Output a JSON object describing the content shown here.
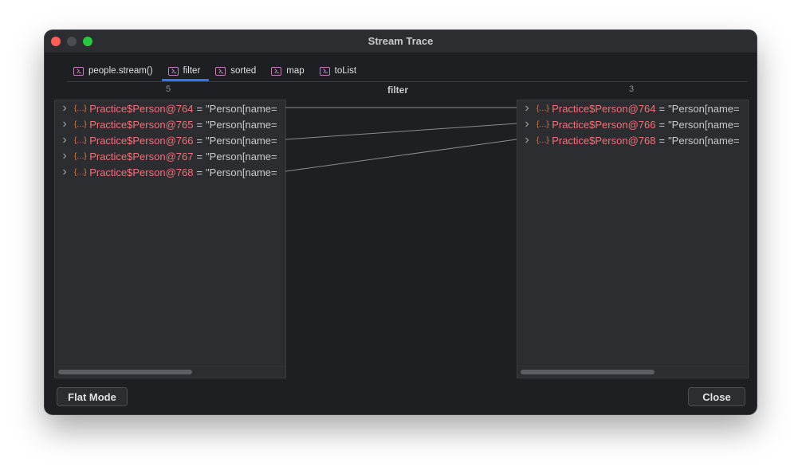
{
  "window": {
    "title": "Stream Trace"
  },
  "tabs": [
    {
      "label": "people.stream()",
      "active": false
    },
    {
      "label": "filter",
      "active": true
    },
    {
      "label": "sorted",
      "active": false
    },
    {
      "label": "map",
      "active": false
    },
    {
      "label": "toList",
      "active": false
    }
  ],
  "section_label": "filter",
  "left_panel": {
    "count": "5",
    "rows": [
      {
        "name": "Practice$Person@764",
        "eq": "=",
        "value": "\"Person[name="
      },
      {
        "name": "Practice$Person@765",
        "eq": "=",
        "value": "\"Person[name="
      },
      {
        "name": "Practice$Person@766",
        "eq": "=",
        "value": "\"Person[name="
      },
      {
        "name": "Practice$Person@767",
        "eq": "=",
        "value": "\"Person[name="
      },
      {
        "name": "Practice$Person@768",
        "eq": "=",
        "value": "\"Person[name="
      }
    ]
  },
  "right_panel": {
    "count": "3",
    "rows": [
      {
        "name": "Practice$Person@764",
        "eq": "=",
        "value": "\"Person[name="
      },
      {
        "name": "Practice$Person@766",
        "eq": "=",
        "value": "\"Person[name="
      },
      {
        "name": "Practice$Person@768",
        "eq": "=",
        "value": "\"Person[name="
      }
    ]
  },
  "mappings": [
    {
      "from": 0,
      "to": 0
    },
    {
      "from": 2,
      "to": 1
    },
    {
      "from": 4,
      "to": 2
    }
  ],
  "buttons": {
    "flat_mode": "Flat Mode",
    "close": "Close"
  },
  "icons": {
    "tab": "console-icon",
    "row": "object-icon",
    "expand": "chevron-right-icon"
  },
  "colors": {
    "accent": "#3574f0",
    "object_name": "#f07178",
    "tab_icon": "#c77dbb"
  }
}
